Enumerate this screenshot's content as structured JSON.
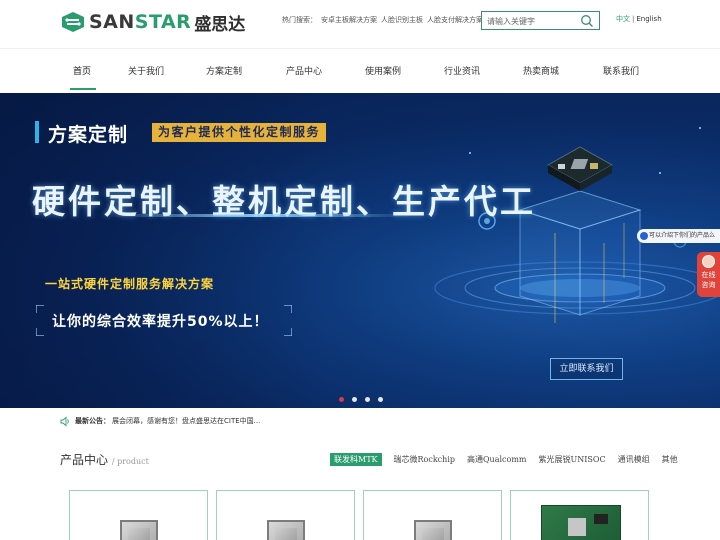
{
  "header": {
    "logo_en_a": "SAN",
    "logo_en_b": "STAR",
    "logo_cn": "盛思达",
    "hot_label": "热门搜索：",
    "hot_links": [
      "安卓主板解决方案",
      "人脸识别主板",
      "人脸支付解决方案"
    ],
    "search_placeholder": "请输入关键字",
    "lang_cn": "中文",
    "lang_sep": "|",
    "lang_en": "English"
  },
  "nav": {
    "items": [
      "首页",
      "关于我们",
      "方案定制",
      "产品中心",
      "使用案例",
      "行业资讯",
      "热卖商城",
      "联系我们"
    ],
    "active_index": 0
  },
  "banner": {
    "tag_title": "方案定制",
    "tag_sub": "为客户提供个性化定制服务",
    "headline": "硬件定制、整机定制、生产代工",
    "subline": "一站式硬件定制服务解决方案",
    "frame_text": "让你的综合效率提升50%以上！",
    "cta": "立即联系我们",
    "slide_count": 4,
    "active_slide": 0
  },
  "float": {
    "tip": "可以介绍下你们的产品么",
    "consult": "在线咨询"
  },
  "notice": {
    "label": "最新公告：",
    "text": "展会闭幕，感谢有您！盘点盛思达在CITE中国..."
  },
  "products": {
    "title": "产品中心",
    "title_en": "/ product",
    "tabs": [
      "联发科MTK",
      "瑞芯微Rockchip",
      "高通Qualcomm",
      "紫光展锐UNISOC",
      "通讯模组",
      "其他"
    ],
    "active_tab": 0
  },
  "colors": {
    "brand_green": "#2a9d6f",
    "banner_blue": "#0f3e83",
    "accent_yellow": "#e7b23a",
    "alert_red": "#e0433a"
  }
}
